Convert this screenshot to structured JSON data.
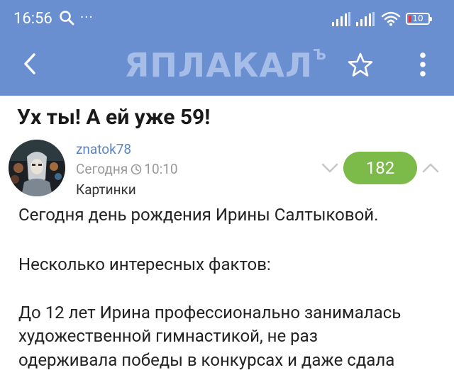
{
  "status_bar": {
    "time": "16:56",
    "more": "···",
    "battery": "10",
    "icons": [
      "search-icon",
      "signal-icon",
      "wifi-icon",
      "battery-icon"
    ]
  },
  "toolbar": {
    "logo_text": "ЯПЛАКАЛ",
    "logo_suffix": "Ъ",
    "icons": [
      "chevron-left-icon",
      "star-outline-icon",
      "kebab-menu-icon"
    ]
  },
  "post": {
    "title": "Ух ты! А ей уже 59!",
    "author": "znatok78",
    "date": "Сегодня",
    "time": "10:10",
    "category": "Картинки",
    "rating": "182",
    "paragraphs": [
      "Сегодня день рождения Ирины Салтыковой.",
      "Несколько интересных фактов:",
      "До 12 лет Ирина профессионально занималась",
      "художественной гимнастикой, не раз",
      "одерживала победы в конкурсах и даже сдала"
    ]
  },
  "colors": {
    "header_bg": "#6a8fd0",
    "rating_bg": "#7cba4a",
    "author_link": "#5b84c4"
  }
}
